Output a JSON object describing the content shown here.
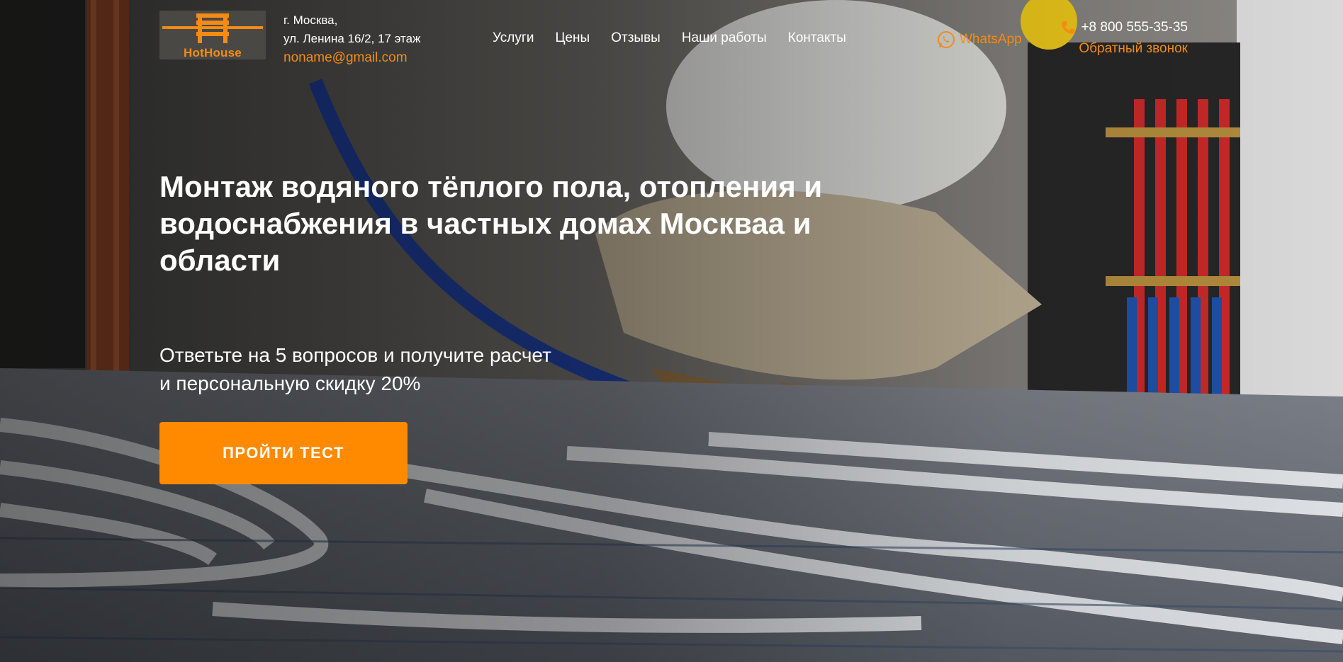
{
  "brand": {
    "logo_text": "HotHouse"
  },
  "contacts": {
    "city": "г. Москва,",
    "street": "ул. Ленина 16/2, 17 этаж",
    "email": "noname@gmail.com",
    "whatsapp_label": "WhatsApp",
    "phone": "+8 800 555-35-35",
    "callback_label": "Обратный звонок"
  },
  "nav": {
    "items": [
      {
        "label": "Услуги"
      },
      {
        "label": "Цены"
      },
      {
        "label": "Отзывы"
      },
      {
        "label": "Наши работы"
      },
      {
        "label": "Контакты"
      }
    ]
  },
  "hero": {
    "title": "Монтаж водяного тёплого пола, отопления и водоснабжения в частных домах Москваа и области",
    "subtitle_line1": "Ответьте на 5 вопросов и получите расчет",
    "subtitle_line2": "и персональную скидку 20%",
    "cta_label": "ПРОЙТИ ТЕСТ"
  },
  "colors": {
    "accent": "#f58b13",
    "button": "#ff8a00",
    "text": "#ffffff"
  },
  "icons": {
    "logo": "bench-icon",
    "whatsapp": "whatsapp-icon",
    "phone": "phone-icon"
  }
}
